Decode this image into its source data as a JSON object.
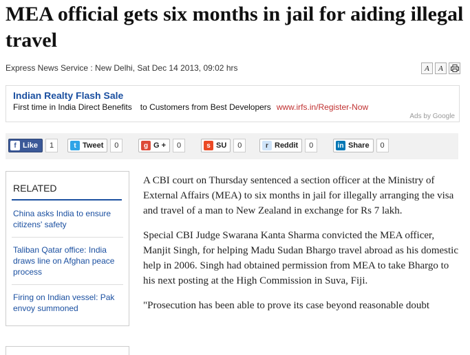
{
  "headline": "MEA official gets six months in jail for aiding illegal travel",
  "byline": "Express News Service : New Delhi, Sat Dec 14 2013, 09:02 hrs",
  "tools": [
    "A",
    "A"
  ],
  "ad": {
    "title": "Indian Realty Flash Sale",
    "text_a": "First time in India Direct Benefits",
    "text_b": "to Customers from Best Developers",
    "url": "www.irfs.in/Register-Now",
    "ads_by": "Ads by Google"
  },
  "share": {
    "like": "Like",
    "like_count": "1",
    "tweet": "Tweet",
    "tweet_count": "0",
    "gplus": "G +",
    "gplus_count": "0",
    "su": "SU",
    "su_count": "0",
    "reddit": "Reddit",
    "reddit_count": "0",
    "linkedin": "Share",
    "linkedin_count": "0"
  },
  "related": {
    "heading": "RELATED",
    "items": [
      "China asks India to ensure citizens' safety",
      "Taliban Qatar office: India draws line on Afghan peace process",
      "Firing on Indian vessel: Pak envoy summoned"
    ]
  },
  "article": [
    "A CBI court on Thursday sentenced a section officer at the Ministry of External Affairs (MEA) to six months in jail for illegally arranging the visa and travel of a man to New Zealand in exchange for Rs 7 lakh.",
    "Special CBI Judge Swarana Kanta Sharma convicted the MEA officer, Manjit Singh, for helping Madu Sudan Bhargo travel abroad as his domestic help in 2006. Singh had obtained permission from MEA to take Bhargo to his next posting at the High Commission in Suva, Fiji.",
    "\"Prosecution has been able to prove its case beyond reasonable doubt"
  ],
  "colors": {
    "link": "#1a4fa0",
    "facebook": "#3b5998",
    "ad_url": "#c03030"
  }
}
